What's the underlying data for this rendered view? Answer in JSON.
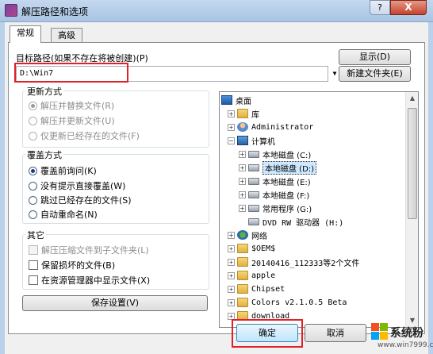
{
  "window": {
    "title": "解压路径和选项",
    "help": "?",
    "close": "X"
  },
  "tabs": [
    "常规",
    "高级"
  ],
  "path": {
    "label": "目标路径(如果不存在将被创建)(P)",
    "value": "D:\\Win7",
    "show_button": "显示(D)",
    "new_folder_button": "新建文件夹(E)"
  },
  "update_mode": {
    "title": "更新方式",
    "options": [
      "解压并替换文件(R)",
      "解压并更新文件(U)",
      "仅更新已经存在的文件(F)"
    ]
  },
  "overwrite_mode": {
    "title": "覆盖方式",
    "options": [
      "覆盖前询问(K)",
      "没有提示直接覆盖(W)",
      "跳过已经存在的文件(S)",
      "自动重命名(N)"
    ]
  },
  "misc": {
    "title": "其它",
    "options": [
      "解压压缩文件到子文件夹(L)",
      "保留损坏的文件(B)",
      "在资源管理器中显示文件(X)"
    ]
  },
  "save_settings": "保存设置(V)",
  "tree": {
    "rows": [
      {
        "label": "桌面"
      },
      {
        "label": "库"
      },
      {
        "label": "Administrator"
      },
      {
        "label": "计算机"
      },
      {
        "label": "本地磁盘 (C:)"
      },
      {
        "label": "本地磁盘 (D:)"
      },
      {
        "label": "本地磁盘 (E:)"
      },
      {
        "label": "本地磁盘 (F:)"
      },
      {
        "label": "常用程序 (G:)"
      },
      {
        "label": "DVD RW 驱动器 (H:)"
      },
      {
        "label": "网络"
      },
      {
        "label": "$OEM$"
      },
      {
        "label": "20140416_112333等2个文件"
      },
      {
        "label": "apple"
      },
      {
        "label": "Chipset"
      },
      {
        "label": "Colors v2.1.0.5 Beta"
      },
      {
        "label": "download"
      }
    ]
  },
  "ok_button": "确定",
  "cancel_button": "取消",
  "watermark": {
    "brand": "系统粉",
    "url": "www.win7999.com"
  }
}
